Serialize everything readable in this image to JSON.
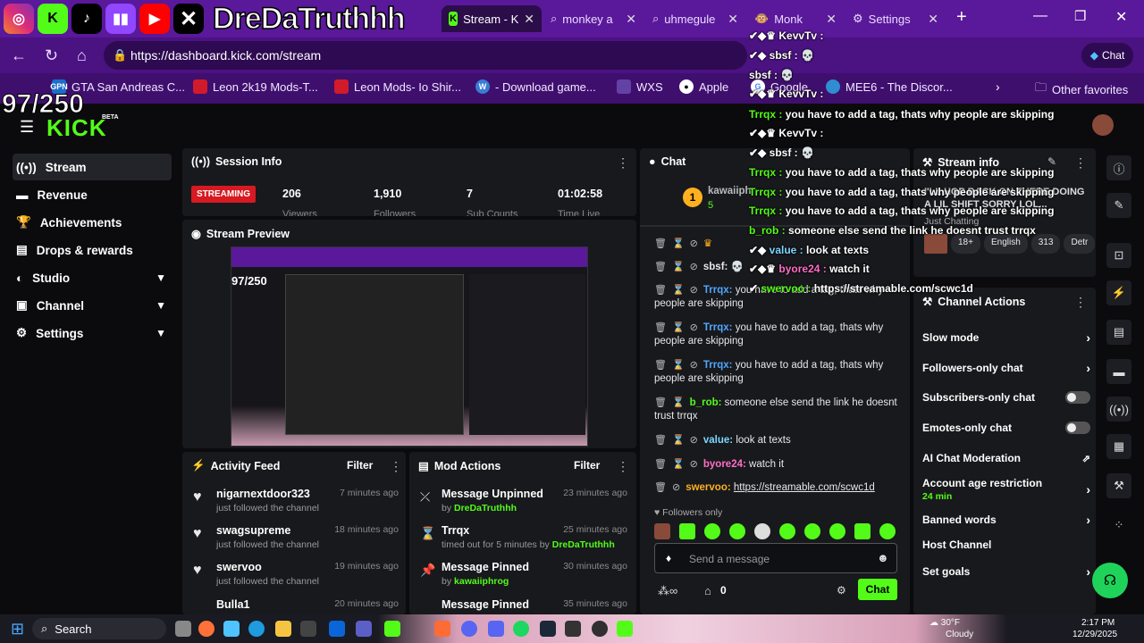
{
  "overlay": {
    "streamer_name": "DreDaTruthhh",
    "counter": "97/250",
    "social_icons": [
      "instagram-icon",
      "kick-icon",
      "tiktok-icon",
      "twitch-icon",
      "youtube-icon",
      "x-icon"
    ]
  },
  "browser": {
    "tabs": [
      {
        "label": "Stream - K",
        "icon": "kick-icon",
        "active": true
      },
      {
        "label": "monkey a",
        "icon": "search-icon",
        "active": false
      },
      {
        "label": "uhmegule",
        "icon": "search-icon",
        "active": false
      },
      {
        "label": "Monk",
        "icon": "monkey-icon",
        "active": false
      },
      {
        "label": "Settings",
        "icon": "gear-icon",
        "active": false
      }
    ],
    "url": "https://dashboard.kick.com/stream",
    "chat_button": "Chat",
    "favorites": [
      {
        "label": "GTA San Andreas C...",
        "badge": "GPN",
        "color": "#1c6ec9"
      },
      {
        "label": "Leon 2k19 Mods-T...",
        "badge": "",
        "color": "#d21b2a"
      },
      {
        "label": "Leon Mods- Io Shir...",
        "badge": "",
        "color": "#d21b2a"
      },
      {
        "label": "- Download game...",
        "badge": "W",
        "color": "#3a7bd5"
      },
      {
        "label": "WXS",
        "badge": "",
        "color": "#6441a5"
      },
      {
        "label": "Apple",
        "badge": "",
        "color": "#222222"
      },
      {
        "label": "Google",
        "badge": "",
        "color": "#ffffff"
      },
      {
        "label": "MEE6 - The Discor...",
        "badge": "",
        "color": "#2f8dd0"
      }
    ],
    "other_favorites": "Other favorites"
  },
  "sidebar": {
    "logo": "KICK",
    "beta": "BETA",
    "items": [
      {
        "label": "Stream",
        "icon": "broadcast-icon",
        "active": true,
        "chevron": false
      },
      {
        "label": "Revenue",
        "icon": "wallet-icon",
        "active": false,
        "chevron": false
      },
      {
        "label": "Achievements",
        "icon": "trophy-icon",
        "active": false,
        "chevron": false
      },
      {
        "label": "Drops & rewards",
        "icon": "gift-icon",
        "active": false,
        "chevron": false
      },
      {
        "label": "Studio",
        "icon": "studio-icon",
        "active": false,
        "chevron": true
      },
      {
        "label": "Channel",
        "icon": "channel-icon",
        "active": false,
        "chevron": true
      },
      {
        "label": "Settings",
        "icon": "gear-icon",
        "active": false,
        "chevron": true
      }
    ]
  },
  "session": {
    "title": "Session Info",
    "status": "STREAMING",
    "stats": [
      {
        "value": "206",
        "label": "Viewers"
      },
      {
        "value": "1,910",
        "label": "Followers"
      },
      {
        "value": "7",
        "label": "Sub Counts"
      },
      {
        "value": "01:02:58",
        "label": "Time Live"
      }
    ]
  },
  "preview": {
    "title": "Stream Preview"
  },
  "activity": {
    "title": "Activity Feed",
    "filter": "Filter",
    "items": [
      {
        "name": "nigarnextdoor323",
        "action": "just followed the channel",
        "time": "7 minutes ago"
      },
      {
        "name": "swagsupreme",
        "action": "just followed the channel",
        "time": "18 minutes ago"
      },
      {
        "name": "swervoo",
        "action": "just followed the channel",
        "time": "19 minutes ago"
      },
      {
        "name": "Bulla1",
        "action": "",
        "time": "20 minutes ago"
      }
    ]
  },
  "mod_actions": {
    "title": "Mod Actions",
    "filter": "Filter",
    "items": [
      {
        "title": "Message Unpinned",
        "detail": "by ",
        "who": "DreDaTruthhh",
        "time": "23 minutes ago",
        "icon": "unpin-icon"
      },
      {
        "title": "Trrqx",
        "detail": "timed out for 5 minutes by ",
        "who": "DreDaTruthhh",
        "time": "25 minutes ago",
        "icon": "hourglass-icon"
      },
      {
        "title": "Message Pinned",
        "detail": "by ",
        "who": "kawaiiphrog",
        "time": "30 minutes ago",
        "icon": "pin-icon"
      },
      {
        "title": "Message Pinned",
        "detail": "",
        "who": "",
        "time": "35 minutes ago",
        "icon": "pin-icon"
      }
    ]
  },
  "chat": {
    "title": "Chat",
    "top_gifter": {
      "name": "kawaiiph",
      "count": "5"
    },
    "messages": [
      {
        "user": "",
        "text": "",
        "color": "#c0c0c0"
      },
      {
        "user": "sbsf:",
        "text": "",
        "color": "#e8e8e8"
      },
      {
        "user": "Trrqx:",
        "text": "you have to add a tag, thats why people are skipping",
        "color": "#4fa7ff"
      },
      {
        "user": "Trrqx:",
        "text": "you have to add a tag, thats why people are skipping",
        "color": "#4fa7ff"
      },
      {
        "user": "Trrqx:",
        "text": "you have to add a tag, thats why people are skipping",
        "color": "#4fa7ff"
      },
      {
        "user": "b_rob:",
        "text": "someone else send the link he doesnt trust trrqx",
        "color": "#53fc18"
      },
      {
        "user": "value:",
        "text": "look at texts",
        "color": "#7bd7ff"
      },
      {
        "user": "byore24:",
        "text": "watch it",
        "color": "#ff6ec7"
      },
      {
        "user": "swervoo:",
        "text": "https://streamable.com/scwc1d",
        "color": "#ffb020"
      }
    ],
    "followers_only": "Followers only",
    "input_placeholder": "Send a message",
    "count": "0",
    "send": "Chat"
  },
  "stream_info": {
    "title": "Stream info",
    "stream_title": "I'LL HOP BACK ON THERE DOING A LIL SHIFT SORRY LOL...",
    "tags": [
      "18+",
      "English",
      "313",
      "Detr"
    ],
    "category": "Just Chatting"
  },
  "channel_actions": {
    "title": "Channel Actions",
    "items": [
      {
        "label": "Slow mode",
        "control": "arrow"
      },
      {
        "label": "Followers-only chat",
        "control": "arrow"
      },
      {
        "label": "Subscribers-only chat",
        "control": "toggle"
      },
      {
        "label": "Emotes-only chat",
        "control": "toggle"
      },
      {
        "label": "AI Chat Moderation",
        "control": "external"
      },
      {
        "label": "Account age restriction",
        "control": "arrow",
        "sub": "24 min"
      },
      {
        "label": "Banned words",
        "control": "arrow"
      },
      {
        "label": "Host Channel",
        "control": "none"
      },
      {
        "label": "Set goals",
        "control": "arrow"
      }
    ]
  },
  "overlay_chat": [
    {
      "user": "KevvTv :",
      "text": "",
      "color": "#ffffff"
    },
    {
      "user": "sbsf :",
      "text": "",
      "color": "#ffffff"
    },
    {
      "user": "sbsf :",
      "text": "",
      "color": "#ffffff"
    },
    {
      "user": "KevvTv :",
      "text": "",
      "color": "#ffffff"
    },
    {
      "user": "Trrqx :",
      "text": "you have to add a tag, thats why people are skipping",
      "color": "#53fc18"
    },
    {
      "user": "KevvTv :",
      "text": "",
      "color": "#ffffff"
    },
    {
      "user": "sbsf :",
      "text": "",
      "color": "#ffffff"
    },
    {
      "user": "Trrqx :",
      "text": "you have to add a tag, thats why people are skipping",
      "color": "#53fc18"
    },
    {
      "user": "Trrqx :",
      "text": "you have to add a tag, thats why people are skipping",
      "color": "#53fc18"
    },
    {
      "user": "Trrqx :",
      "text": "you have to add a tag, thats why people are skipping",
      "color": "#53fc18"
    },
    {
      "user": "b_rob :",
      "text": "someone else send the link he doesnt trust trrqx",
      "color": "#53fc18"
    },
    {
      "user": "value :",
      "text": "look at texts",
      "color": "#7bd7ff"
    },
    {
      "user": "byore24 :",
      "text": "watch it",
      "color": "#ff6ec7"
    },
    {
      "user": "swervoo :",
      "text": "https://streamable.com/scwc1d",
      "color": "#53fc18"
    }
  ],
  "taskbar": {
    "search": "Search",
    "weather": "30°F",
    "weather_desc": "Cloudy",
    "time": "2:17 PM",
    "date": "12/29/2025"
  }
}
